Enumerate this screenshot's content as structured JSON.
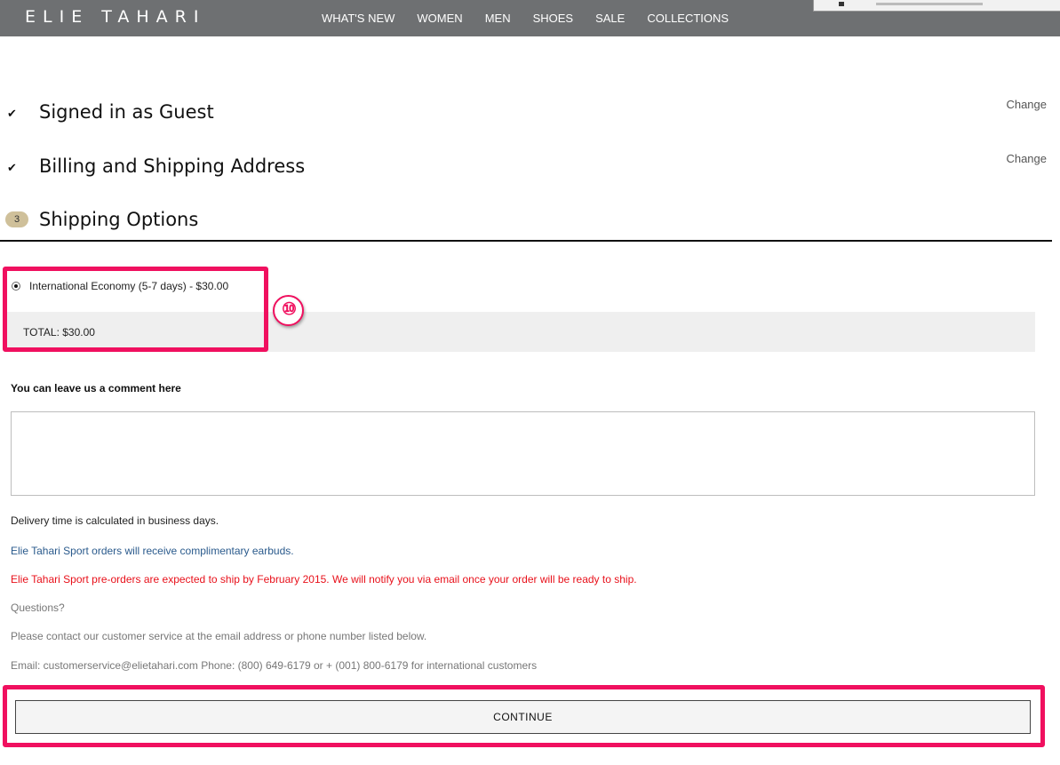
{
  "header": {
    "logo": "ELIE TAHARI",
    "nav": [
      "WHAT'S NEW",
      "WOMEN",
      "MEN",
      "SHOES",
      "SALE",
      "COLLECTIONS"
    ]
  },
  "steps": {
    "guest": {
      "title": "Signed in as Guest",
      "change": "Change"
    },
    "address": {
      "title": "Billing and Shipping Address",
      "change": "Change"
    },
    "shipping": {
      "number": "3",
      "title": "Shipping Options"
    }
  },
  "shipping": {
    "option_label": "International Economy (5-7 days) - $30.00",
    "selected": true,
    "total": "TOTAL: $30.00"
  },
  "annotation": {
    "badge": "⑩",
    "color": "#f0105f"
  },
  "comment": {
    "label": "You can leave us a comment here",
    "value": "",
    "placeholder": ""
  },
  "info": {
    "delivery": "Delivery time is calculated in business days.",
    "earbuds": "Elie Tahari Sport orders will receive complimentary earbuds.",
    "preorder": "Elie Tahari Sport pre-orders are expected to ship by February 2015. We will notify you via email once your order will be ready to ship.",
    "questions": "Questions?",
    "contact": "Please contact our customer service at the email address or phone number listed below.",
    "email_phone": "Email: customerservice@elietahari.com Phone: (800) 649-6179 or + (001) 800-6179 for international customers"
  },
  "continue_label": "CONTINUE",
  "colors": {
    "header_bg": "#6e7072",
    "step_badge": "#cfc09a",
    "link_blue": "#2a5a8c",
    "alert_red": "#e8101a",
    "highlight": "#f0105f"
  }
}
